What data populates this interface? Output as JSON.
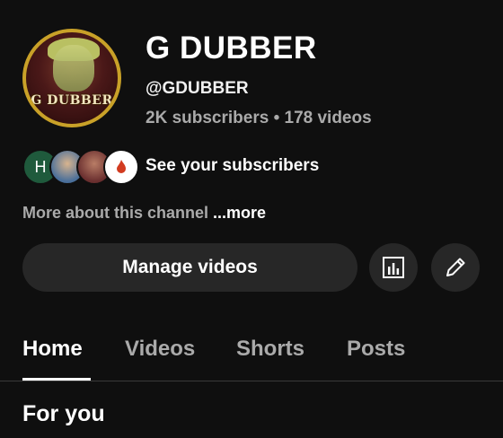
{
  "channel": {
    "name": "G DUBBER",
    "handle": "@GDUBBER",
    "stats": "2K subscribers • 178 videos",
    "avatar_text": "G DUBBER"
  },
  "subscribers": {
    "label": "See your subscribers",
    "initial": "H"
  },
  "about": {
    "text": "More about this channel",
    "more": " ...more"
  },
  "actions": {
    "manage_label": "Manage videos",
    "analytics_icon": "analytics-icon",
    "edit_icon": "pencil-icon"
  },
  "tabs": [
    {
      "label": "Home"
    },
    {
      "label": "Videos"
    },
    {
      "label": "Shorts"
    },
    {
      "label": "Posts"
    }
  ],
  "section": {
    "title": "For you"
  },
  "colors": {
    "background": "#0f0f0f",
    "button_bg": "#272727",
    "secondary_text": "#aaaaaa",
    "avatar_ring": "#c9a128"
  }
}
